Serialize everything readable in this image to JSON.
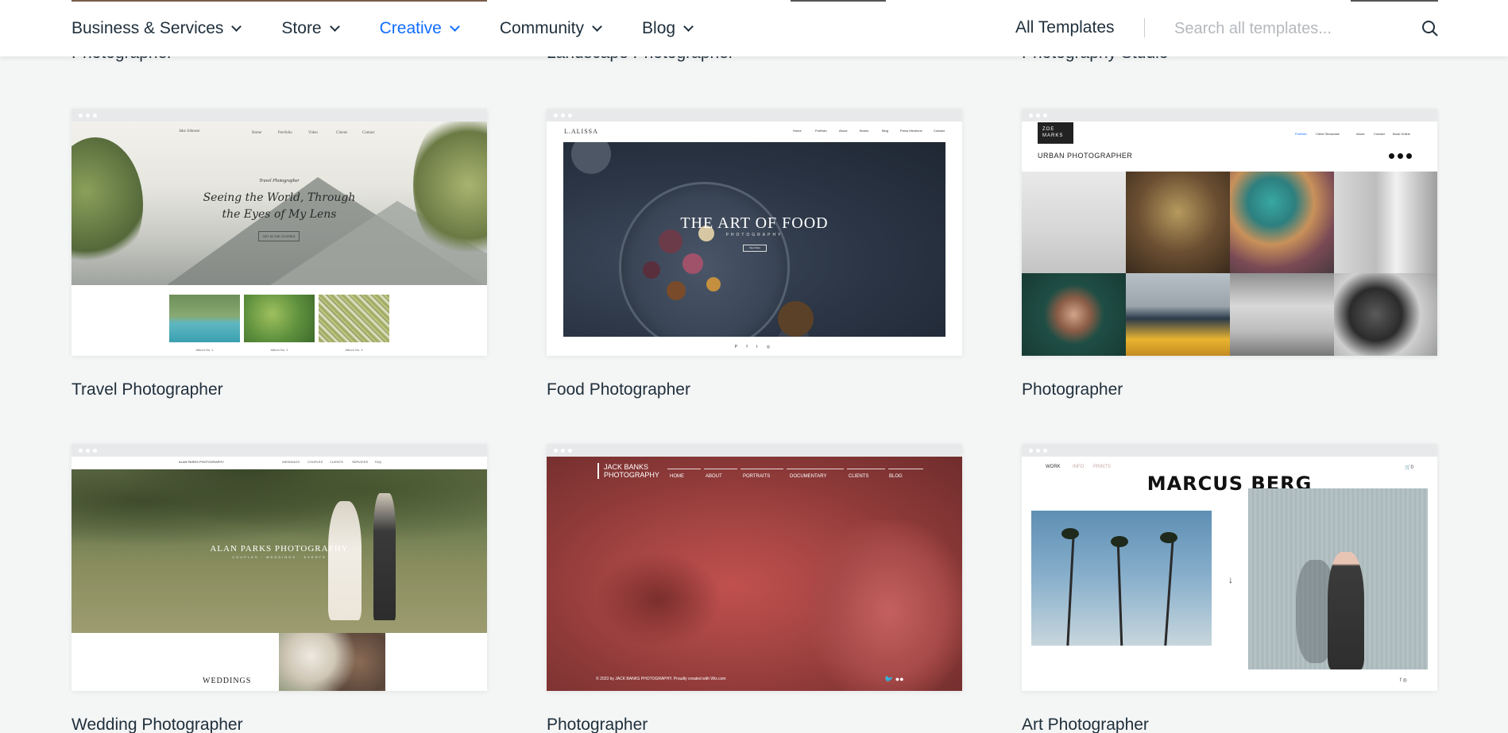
{
  "nav": {
    "items": [
      {
        "label": "Business & Services",
        "active": false
      },
      {
        "label": "Store",
        "active": false
      },
      {
        "label": "Creative",
        "active": true
      },
      {
        "label": "Community",
        "active": false
      },
      {
        "label": "Blog",
        "active": false
      }
    ],
    "all_templates": "All Templates",
    "search_placeholder": "Search all templates...",
    "accent_color": "#116dff"
  },
  "partial_row": [
    "Photographer",
    "Landscape Photographer",
    "Photography Studio"
  ],
  "templates": [
    {
      "title": "Travel Photographer",
      "preview": {
        "site_name": "Jake Johnson",
        "nav": [
          "Home",
          "Portfolio",
          "Video",
          "Clients",
          "Contact"
        ],
        "kicker": "Travel Photographer",
        "headline_1": "Seeing the World, Through",
        "headline_2": "the Eyes of My Lens",
        "button": "GET IN THE STORIES",
        "albums": [
          "Album No. 1",
          "Album No. 2",
          "Album No. 3"
        ]
      }
    },
    {
      "title": "Food Photographer",
      "preview": {
        "logo": "L.ALISSA",
        "nav": [
          "Home",
          "Portfolio",
          "About",
          "Books",
          "Blog",
          "Press Mentions",
          "Contact"
        ],
        "headline": "THE ART OF FOOD",
        "sub": "PHOTOGRAPHY",
        "button": "View More",
        "social": "P f t ◎"
      }
    },
    {
      "title": "Photographer",
      "preview": {
        "logo": "ZOE MARKS",
        "nav": [
          "Portfolio",
          "Client Showcase",
          "About",
          "Contact",
          "Book Online"
        ],
        "heading": "URBAN PHOTOGRAPHER"
      }
    },
    {
      "title": "Wedding Photographer",
      "preview": {
        "logo": "ALAN PARKS PHOTOGRAPHY",
        "nav": [
          "WEDDINGS",
          "COUPLES",
          "CLIENTS",
          "SERVICES",
          "FAQ"
        ],
        "headline": "ALAN PARKS PHOTOGRAPHY",
        "sub": "COUPLES · WEDDINGS · EVENTS",
        "section": "WEDDINGS"
      }
    },
    {
      "title": "Photographer",
      "preview": {
        "logo_1": "JACK BANKS",
        "logo_2": "PHOTOGRAPHY",
        "nav": [
          "HOME",
          "ABOUT",
          "PORTRAITS",
          "DOCUMENTARY",
          "CLIENTS",
          "BLOG"
        ],
        "footer": "© 2023 by JACK BANKS PHOTOGRAPHY. Proudly created with Wix.com",
        "social": "🐦 ●●"
      }
    },
    {
      "title": "Art Photographer",
      "preview": {
        "nav": [
          "WORK",
          "INFO",
          "PRINTS"
        ],
        "headline": "MARCUS BERG",
        "cart": "🛒0",
        "arrow": "↓",
        "social": "f ◎"
      }
    }
  ]
}
